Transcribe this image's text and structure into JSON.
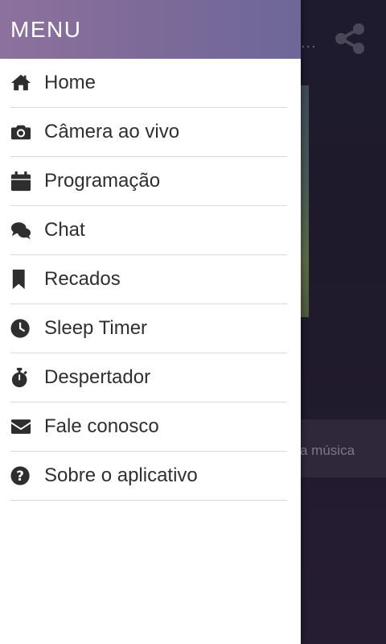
{
  "drawer": {
    "title": "MENU",
    "items": [
      {
        "label": "Home",
        "icon": "home-icon"
      },
      {
        "label": "Câmera ao vivo",
        "icon": "camera-icon"
      },
      {
        "label": "Programação",
        "icon": "calendar-icon"
      },
      {
        "label": "Chat",
        "icon": "chat-bubbles-icon"
      },
      {
        "label": "Recados",
        "icon": "bookmark-icon"
      },
      {
        "label": "Sleep Timer",
        "icon": "clock-icon"
      },
      {
        "label": "Despertador",
        "icon": "stopwatch-icon"
      },
      {
        "label": "Fale conosco",
        "icon": "envelope-icon"
      },
      {
        "label": "Sobre o aplicativo",
        "icon": "question-circle-icon"
      }
    ]
  },
  "background": {
    "header_dots": "...",
    "share_icon": "share-icon",
    "song_text": "a música"
  },
  "colors": {
    "header_gradient_start": "#8d719d",
    "header_gradient_end": "#6d6899",
    "background_dark": "#1e1a2c",
    "icon_color": "#2e2e2e"
  }
}
